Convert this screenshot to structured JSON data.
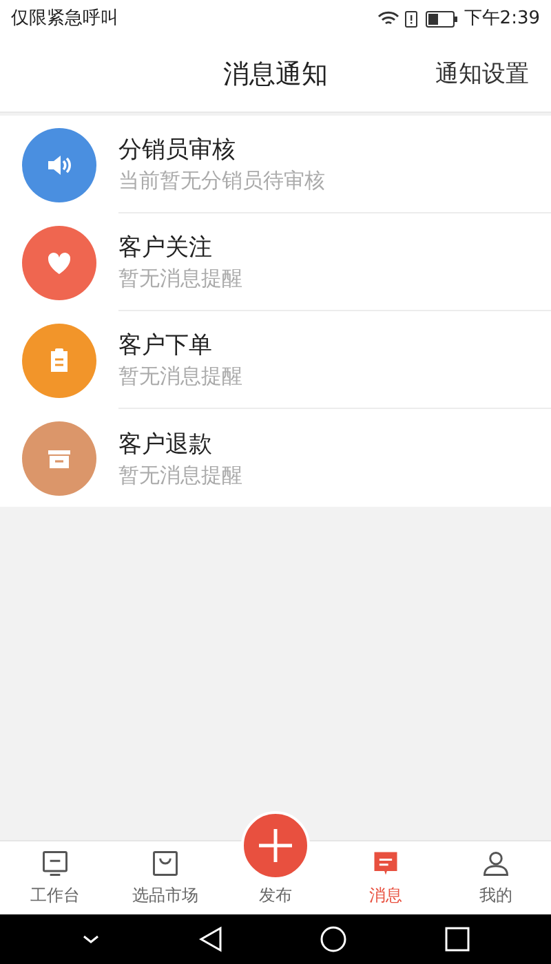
{
  "status_bar": {
    "carrier": "仅限紧急呼叫",
    "time": "下午2:39"
  },
  "header": {
    "title": "消息通知",
    "action": "通知设置"
  },
  "notifications": [
    {
      "kind": "speaker",
      "color": "#4a8fe0",
      "title": "分销员审核",
      "subtitle": "当前暂无分销员待审核"
    },
    {
      "kind": "heart",
      "color": "#ef6650",
      "title": "客户关注",
      "subtitle": "暂无消息提醒"
    },
    {
      "kind": "clipboard",
      "color": "#f2952a",
      "title": "客户下单",
      "subtitle": "暂无消息提醒"
    },
    {
      "kind": "box",
      "color": "#db966a",
      "title": "客户退款",
      "subtitle": "暂无消息提醒"
    }
  ],
  "tab_bar": [
    {
      "kind": "monitor",
      "label": "工作台",
      "selected": false
    },
    {
      "kind": "bag",
      "label": "选品市场",
      "selected": false
    },
    {
      "kind": "plus",
      "label": "发布",
      "selected": false
    },
    {
      "kind": "message",
      "label": "消息",
      "selected": true
    },
    {
      "kind": "person",
      "label": "我的",
      "selected": false
    }
  ]
}
